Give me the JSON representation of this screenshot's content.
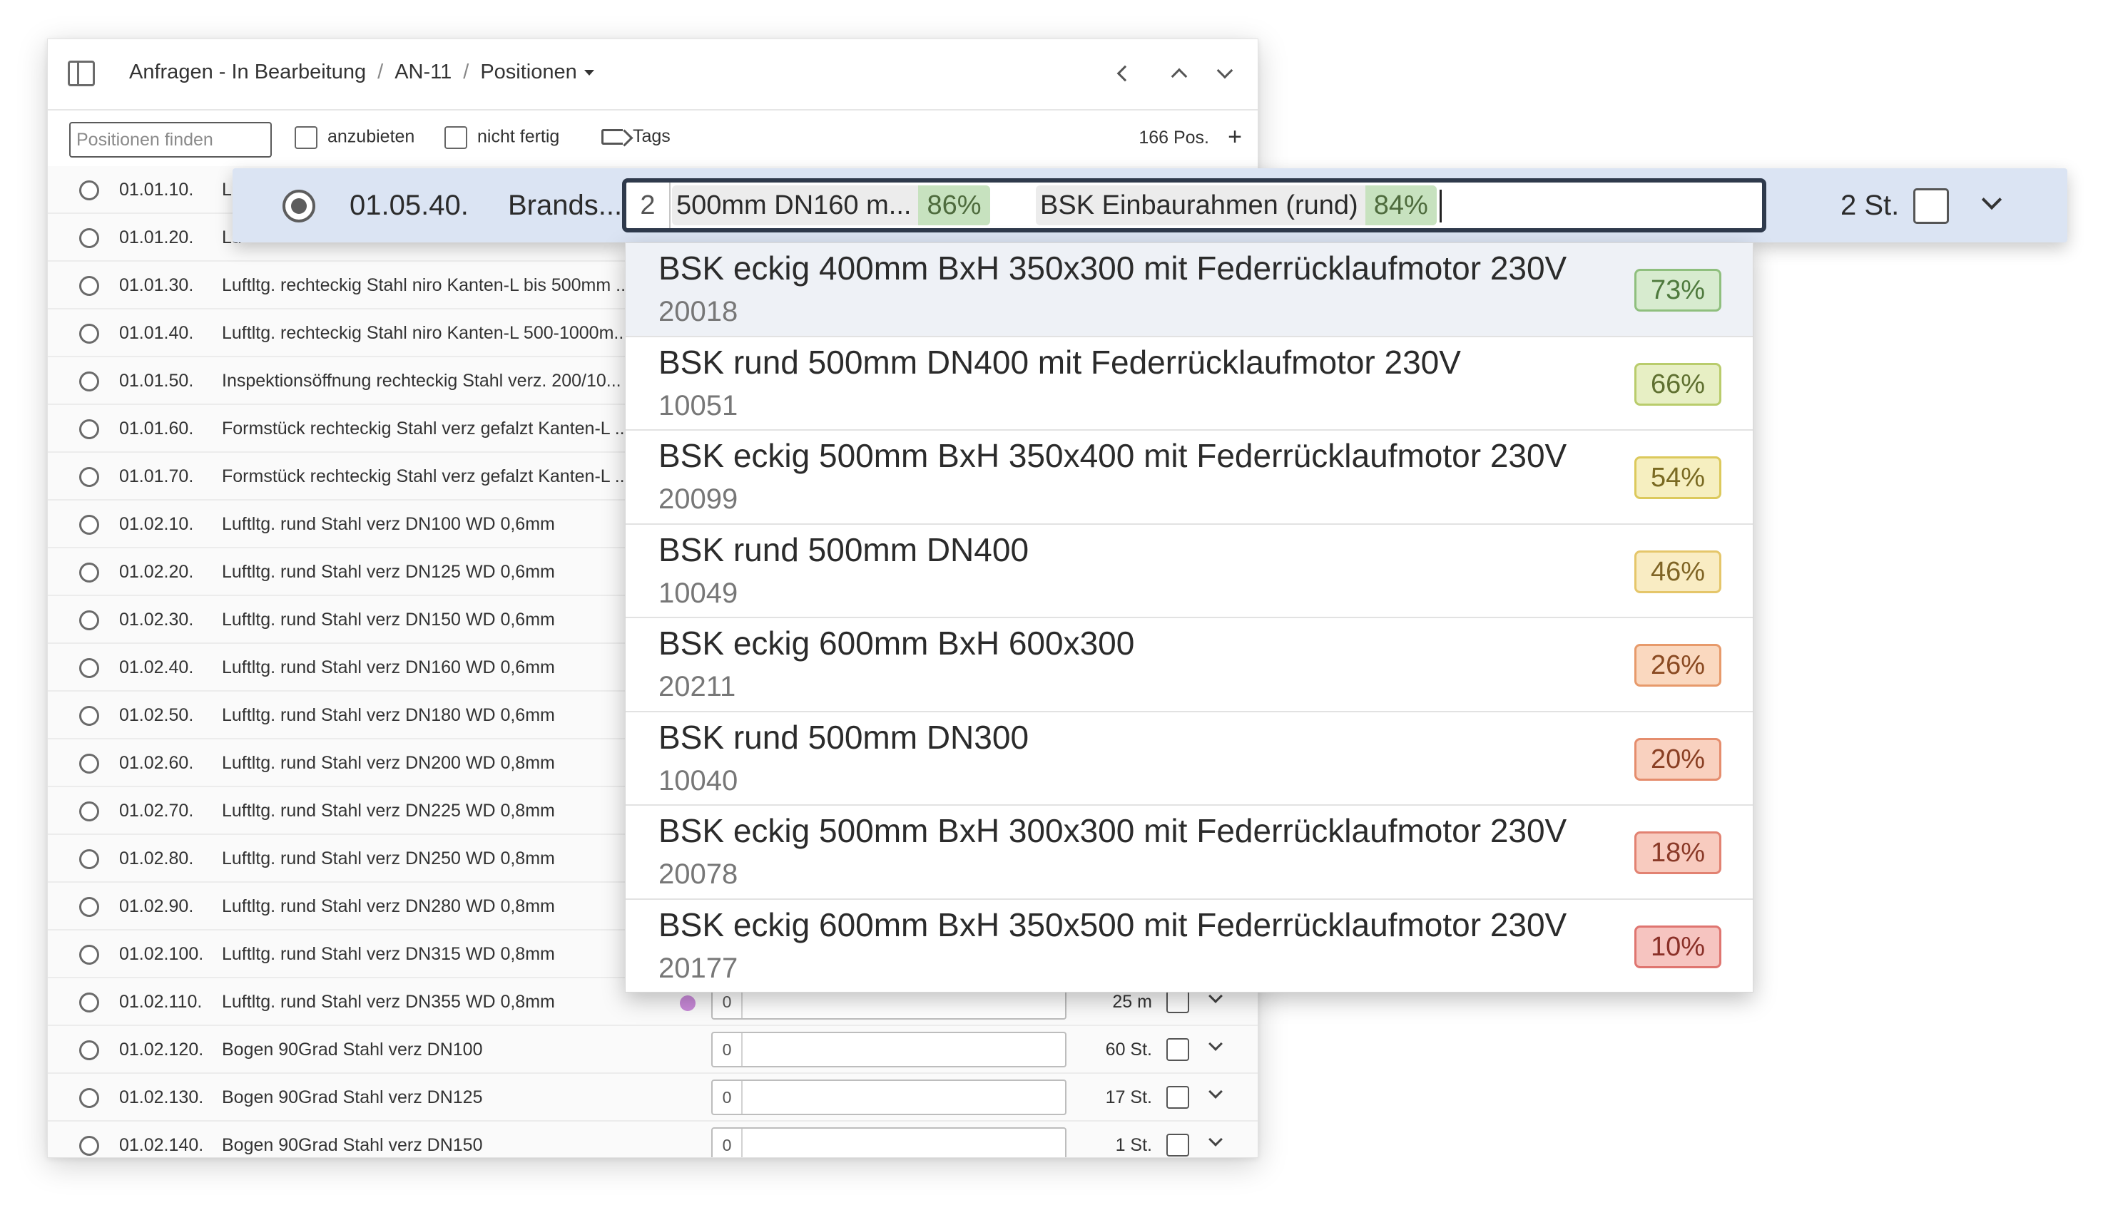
{
  "header": {
    "breadcrumb": [
      "Anfragen - In Bearbeitung",
      "AN-11",
      "Positionen"
    ]
  },
  "toolbar": {
    "search_placeholder": "Positionen finden",
    "filter_anzubieten": "anzubieten",
    "filter_nicht_fertig": "nicht fertig",
    "tags_label": "Tags",
    "position_count": "166 Pos.",
    "add_symbol": "+"
  },
  "rows": [
    {
      "num": "01.01.10.",
      "desc": "Lu",
      "unit": "",
      "qty": ""
    },
    {
      "num": "01.01.20.",
      "desc": "Lu",
      "unit": "",
      "qty": ""
    },
    {
      "num": "01.01.30.",
      "desc": "Luftltg. rechteckig Stahl niro Kanten-L bis 500mm ...",
      "unit": "",
      "qty": ""
    },
    {
      "num": "01.01.40.",
      "desc": "Luftltg. rechteckig Stahl niro Kanten-L 500-1000m...",
      "unit": "",
      "qty": ""
    },
    {
      "num": "01.01.50.",
      "desc": "Inspektionsöffnung rechteckig Stahl verz. 200/10...",
      "unit": "",
      "qty": ""
    },
    {
      "num": "01.01.60.",
      "desc": "Formstück rechteckig Stahl verz gefalzt Kanten-L ...",
      "unit": "",
      "qty": ""
    },
    {
      "num": "01.01.70.",
      "desc": "Formstück rechteckig Stahl verz gefalzt Kanten-L ...",
      "unit": "",
      "qty": ""
    },
    {
      "num": "01.02.10.",
      "desc": "Luftltg. rund Stahl verz DN100 WD 0,6mm",
      "unit": "",
      "qty": ""
    },
    {
      "num": "01.02.20.",
      "desc": "Luftltg. rund Stahl verz DN125 WD 0,6mm",
      "unit": "",
      "qty": ""
    },
    {
      "num": "01.02.30.",
      "desc": "Luftltg. rund Stahl verz DN150 WD 0,6mm",
      "unit": "",
      "qty": ""
    },
    {
      "num": "01.02.40.",
      "desc": "Luftltg. rund Stahl verz DN160 WD 0,6mm",
      "unit": "",
      "qty": ""
    },
    {
      "num": "01.02.50.",
      "desc": "Luftltg. rund Stahl verz DN180 WD 0,6mm",
      "unit": "",
      "qty": ""
    },
    {
      "num": "01.02.60.",
      "desc": "Luftltg. rund Stahl verz DN200 WD 0,8mm",
      "unit": "",
      "qty": ""
    },
    {
      "num": "01.02.70.",
      "desc": "Luftltg. rund Stahl verz DN225 WD 0,8mm",
      "unit": "",
      "qty": ""
    },
    {
      "num": "01.02.80.",
      "desc": "Luftltg. rund Stahl verz DN250 WD 0,8mm",
      "unit": "",
      "qty": ""
    },
    {
      "num": "01.02.90.",
      "desc": "Luftltg. rund Stahl verz DN280 WD 0,8mm",
      "unit": "",
      "qty": ""
    },
    {
      "num": "01.02.100.",
      "desc": "Luftltg. rund Stahl verz DN315 WD 0,8mm",
      "unit": "",
      "qty": ""
    },
    {
      "num": "01.02.110.",
      "desc": "Luftltg. rund Stahl verz DN355 WD 0,8mm",
      "unit": "25 m",
      "qty": "0",
      "dot": true
    },
    {
      "num": "01.02.120.",
      "desc": "Bogen 90Grad Stahl verz DN100",
      "unit": "60 St.",
      "qty": "0"
    },
    {
      "num": "01.02.130.",
      "desc": "Bogen 90Grad Stahl verz DN125",
      "unit": "17 St.",
      "qty": "0"
    },
    {
      "num": "01.02.140.",
      "desc": "Bogen 90Grad Stahl verz DN150",
      "unit": "1 St.",
      "qty": "0"
    }
  ],
  "active_row": {
    "num": "01.05.40.",
    "desc": "Brands...",
    "tag_count": "2",
    "chips": [
      {
        "label": "500mm DN160 m...",
        "pct": "86%"
      },
      {
        "label": "BSK Einbaurahmen (rund)",
        "pct": "84%"
      }
    ],
    "unit": "2 St."
  },
  "dropdown": {
    "options": [
      {
        "name": "BSK eckig 400mm BxH 350x300 mit Federrücklaufmotor 230V",
        "code": "20018",
        "pct": "73%",
        "bg": "#d7ebcf",
        "border": "#8fbf7e",
        "color": "#4f7a3e"
      },
      {
        "name": "BSK rund 500mm DN400 mit Federrücklaufmotor 230V",
        "code": "10051",
        "pct": "66%",
        "bg": "#e7efc4",
        "border": "#b9cc6c",
        "color": "#5f7030"
      },
      {
        "name": "BSK eckig 500mm BxH 350x400 mit Federrücklaufmotor 230V",
        "code": "20099",
        "pct": "54%",
        "bg": "#f6efc0",
        "border": "#dcc95c",
        "color": "#7a6a22"
      },
      {
        "name": "BSK rund 500mm DN400",
        "code": "10049",
        "pct": "46%",
        "bg": "#f9ecc3",
        "border": "#e5c66a",
        "color": "#7f6425"
      },
      {
        "name": "BSK eckig 600mm BxH 600x300",
        "code": "20211",
        "pct": "26%",
        "bg": "#fad8bf",
        "border": "#e79a6b",
        "color": "#8a4a22"
      },
      {
        "name": "BSK rund 500mm DN300",
        "code": "10040",
        "pct": "20%",
        "bg": "#f9d1bf",
        "border": "#e58d6d",
        "color": "#8a4024"
      },
      {
        "name": "BSK eckig 500mm BxH 300x300 mit Federrücklaufmotor 230V",
        "code": "20078",
        "pct": "18%",
        "bg": "#f8cbbf",
        "border": "#e28272",
        "color": "#8a3a28"
      },
      {
        "name": "BSK eckig 600mm BxH 350x500 mit Federrücklaufmotor 230V",
        "code": "20177",
        "pct": "10%",
        "bg": "#f6c4c0",
        "border": "#df7570",
        "color": "#8a3028"
      }
    ]
  }
}
